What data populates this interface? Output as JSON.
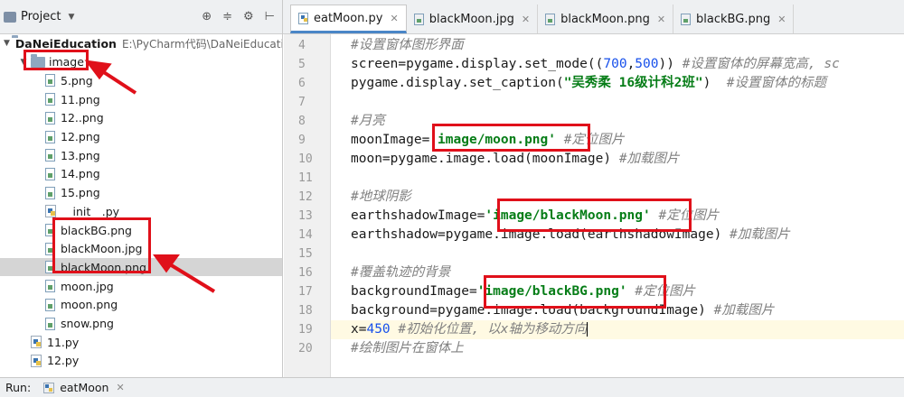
{
  "project_panel": {
    "title": "Project",
    "tool_icons": [
      "target-icon",
      "sort-icon",
      "gear-icon",
      "collapse-icon"
    ],
    "tree": [
      {
        "label": "DaNeiEducation",
        "path": "E:\\PyCharm代码\\DaNeiEducatio",
        "kind": "folder",
        "indent": 0,
        "expanded": true
      },
      {
        "label": "image",
        "kind": "folder",
        "indent": 1,
        "expanded": true
      },
      {
        "label": "5.png",
        "kind": "png",
        "indent": 2
      },
      {
        "label": "11.png",
        "kind": "png",
        "indent": 2
      },
      {
        "label": "12..png",
        "kind": "png",
        "indent": 2
      },
      {
        "label": "12.png",
        "kind": "png",
        "indent": 2
      },
      {
        "label": "13.png",
        "kind": "png",
        "indent": 2
      },
      {
        "label": "14.png",
        "kind": "png",
        "indent": 2
      },
      {
        "label": "15.png",
        "kind": "png",
        "indent": 2
      },
      {
        "label": "__init__.py",
        "kind": "py",
        "indent": 2
      },
      {
        "label": "blackBG.png",
        "kind": "png",
        "indent": 2
      },
      {
        "label": "blackMoon.jpg",
        "kind": "png",
        "indent": 2
      },
      {
        "label": "blackMoon.png",
        "kind": "png",
        "indent": 2,
        "selected": true
      },
      {
        "label": "moon.jpg",
        "kind": "png",
        "indent": 2
      },
      {
        "label": "moon.png",
        "kind": "png",
        "indent": 2
      },
      {
        "label": "snow.png",
        "kind": "png",
        "indent": 2
      },
      {
        "label": "11.py",
        "kind": "py",
        "indent": 1
      },
      {
        "label": "12.py",
        "kind": "py",
        "indent": 1
      }
    ]
  },
  "editor": {
    "tabs": [
      {
        "label": "eatMoon.py",
        "kind": "py",
        "active": true
      },
      {
        "label": "blackMoon.jpg",
        "kind": "png"
      },
      {
        "label": "blackMoon.png",
        "kind": "png"
      },
      {
        "label": "blackBG.png",
        "kind": "png"
      }
    ],
    "lines": [
      {
        "num": "4",
        "parts": [
          [
            "cmt",
            "#设置窗体图形界面"
          ]
        ]
      },
      {
        "num": "5",
        "parts": [
          [
            "kw",
            "screen=pygame.display.set_mode(("
          ],
          [
            "num",
            "700"
          ],
          [
            "kw",
            ","
          ],
          [
            "num",
            "500"
          ],
          [
            "kw",
            ")) "
          ],
          [
            "cmt",
            "#设置窗体的屏幕宽高, sc"
          ]
        ]
      },
      {
        "num": "6",
        "parts": [
          [
            "kw",
            "pygame.display.set_caption("
          ],
          [
            "str",
            "\"吴秀柔 16级计科2班\""
          ],
          [
            "kw",
            ")  "
          ],
          [
            "cmt",
            "#设置窗体的标题"
          ]
        ]
      },
      {
        "num": "7",
        "parts": []
      },
      {
        "num": "8",
        "parts": [
          [
            "cmt",
            "#月亮"
          ]
        ]
      },
      {
        "num": "9",
        "parts": [
          [
            "kw",
            "moonImage="
          ],
          [
            "str",
            "'image/moon.png'"
          ],
          [
            "kw",
            " "
          ],
          [
            "cmt",
            "#定位图片"
          ]
        ]
      },
      {
        "num": "10",
        "parts": [
          [
            "kw",
            "moon=pygame.image.load(moonImage) "
          ],
          [
            "cmt",
            "#加载图片"
          ]
        ]
      },
      {
        "num": "11",
        "parts": []
      },
      {
        "num": "12",
        "parts": [
          [
            "cmt",
            "#地球阴影"
          ]
        ]
      },
      {
        "num": "13",
        "parts": [
          [
            "kw",
            "earthshadowImage="
          ],
          [
            "str",
            "'image/blackMoon.png'"
          ],
          [
            "kw",
            " "
          ],
          [
            "cmt",
            "#定位图片"
          ]
        ]
      },
      {
        "num": "14",
        "parts": [
          [
            "kw",
            "earthshadow=pygame.image.load(earthshadowImage) "
          ],
          [
            "cmt",
            "#加载图片"
          ]
        ]
      },
      {
        "num": "15",
        "parts": []
      },
      {
        "num": "16",
        "parts": [
          [
            "cmt",
            "#覆盖轨迹的背景"
          ]
        ]
      },
      {
        "num": "17",
        "parts": [
          [
            "kw",
            "backgroundImage="
          ],
          [
            "str",
            "'image/blackBG.png'"
          ],
          [
            "kw",
            " "
          ],
          [
            "cmt",
            "#定位图片"
          ]
        ]
      },
      {
        "num": "18",
        "parts": [
          [
            "kw",
            "background=pygame.image.load(backgroundImage) "
          ],
          [
            "cmt",
            "#加载图片"
          ]
        ]
      },
      {
        "num": "19",
        "parts": [
          [
            "kw",
            "x="
          ],
          [
            "num",
            "450"
          ],
          [
            "kw",
            " "
          ],
          [
            "cmt",
            "#初始化位置, 以x轴为移动方向"
          ]
        ],
        "current": true
      },
      {
        "num": "20",
        "parts": [
          [
            "cmt",
            "#绘制图片在窗体上"
          ]
        ]
      }
    ]
  },
  "run_bar": {
    "label": "Run:",
    "tab_label": "eatMoon"
  },
  "colors": {
    "highlight": "#e0101a",
    "string": "#067d17",
    "comment": "#808080",
    "number": "#1750eb",
    "active_tab_underline": "#4a86c7"
  }
}
